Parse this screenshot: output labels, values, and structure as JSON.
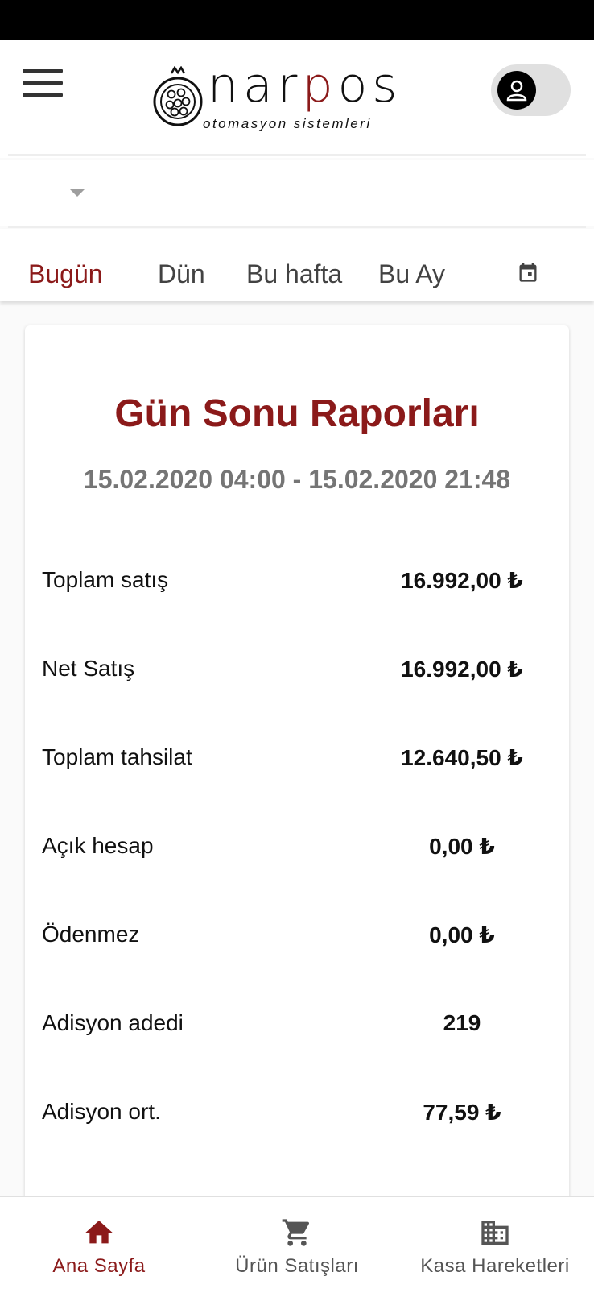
{
  "brand": {
    "name_start": "nar",
    "name_accent": "p",
    "name_end": "os",
    "tagline": "otomasyon sistemleri",
    "accent_color": "#8b1a1a"
  },
  "header": {
    "menu_icon": "hamburger-icon",
    "account_icon": "user-icon"
  },
  "filter": {
    "selected_value": "",
    "arrow_icon": "dropdown-arrow-icon"
  },
  "tabs": [
    {
      "label": "Bugün",
      "active": true
    },
    {
      "label": "Dün",
      "active": false
    },
    {
      "label": "Bu hafta",
      "active": false
    },
    {
      "label": "Bu Ay",
      "active": false
    }
  ],
  "calendar_icon": "calendar-icon",
  "report": {
    "title": "Gün Sonu Raporları",
    "date_range": "15.02.2020 04:00 - 15.02.2020 21:48",
    "rows": [
      {
        "label": "Toplam satış",
        "value": "16.992,00 ₺"
      },
      {
        "label": "Net Satış",
        "value": "16.992,00 ₺"
      },
      {
        "label": "Toplam tahsilat",
        "value": "12.640,50 ₺"
      },
      {
        "label": "Açık hesap",
        "value": "0,00 ₺"
      },
      {
        "label": "Ödenmez",
        "value": "0,00 ₺"
      },
      {
        "label": "Adisyon adedi",
        "value": "219"
      },
      {
        "label": "Adisyon ort.",
        "value": "77,59 ₺"
      }
    ]
  },
  "bottom_nav": [
    {
      "label": "Ana Sayfa",
      "icon": "home-icon",
      "active": true
    },
    {
      "label": "Ürün Satışları",
      "icon": "cart-icon",
      "active": false
    },
    {
      "label": "Kasa Hareketleri",
      "icon": "building-icon",
      "active": false
    }
  ]
}
